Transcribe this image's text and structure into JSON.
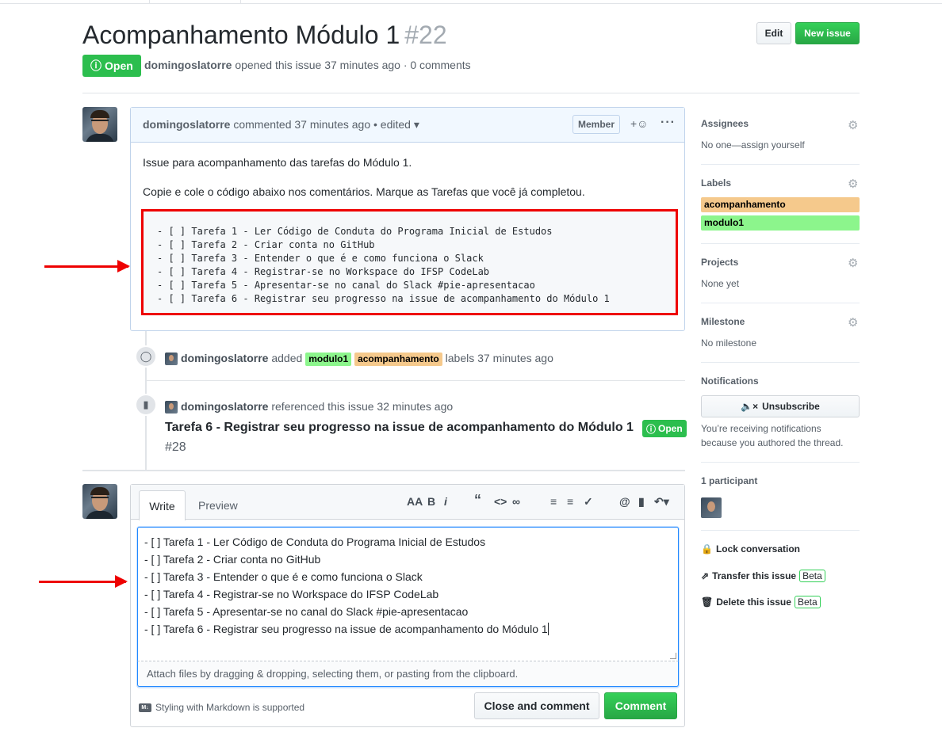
{
  "issue": {
    "title": "Acompanhamento Módulo 1",
    "number": "#22",
    "state": "Open",
    "author": "domingoslatorre",
    "meta_rest": "opened this issue 37 minutes ago · 0 comments"
  },
  "header_buttons": {
    "edit": "Edit",
    "new_issue": "New issue"
  },
  "comment": {
    "author": "domingoslatorre",
    "action": "commented 37 minutes ago • edited",
    "badge": "Member",
    "react": "+☺",
    "more": "···",
    "paragraph1": "Issue para acompanhamento das tarefas do Módulo 1.",
    "paragraph2": "Copie e cole o código abaixo nos comentários. Marque as Tarefas que você já completou.",
    "code_lines": [
      "- [ ] Tarefa 1 - Ler Código de Conduta do Programa Inicial de Estudos",
      "- [ ] Tarefa 2 - Criar conta no GitHub",
      "- [ ] Tarefa 3 - Entender o que é e como funciona o Slack",
      "- [ ] Tarefa 4 - Registrar-se no Workspace do IFSP CodeLab",
      "- [ ] Tarefa 5 - Apresentar-se no canal do Slack #pie-apresentacao",
      "- [ ] Tarefa 6 - Registrar seu progresso na issue de acompanhamento do Módulo 1"
    ]
  },
  "events": {
    "labels_event": {
      "author": "domingoslatorre",
      "verb": "added",
      "label1": "modulo1",
      "label2": "acompanhamento",
      "suffix": "labels 37 minutes ago"
    },
    "ref_event": {
      "author": "domingoslatorre",
      "text": "referenced this issue 32 minutes ago",
      "title": "Tarefa 6 - Registrar seu progresso na issue de acompanhamento do Módulo 1",
      "state": "Open",
      "number": "#28"
    }
  },
  "editor": {
    "tab_write": "Write",
    "tab_preview": "Preview",
    "lines": [
      "- [ ] Tarefa 1 - Ler Código de Conduta do Programa Inicial de Estudos",
      "- [ ] Tarefa 2 - Criar conta no GitHub",
      "- [ ] Tarefa 3 - Entender o que é e como funciona o Slack",
      "- [ ] Tarefa 4 - Registrar-se no Workspace do IFSP CodeLab",
      "- [ ] Tarefa 5 - Apresentar-se no canal do Slack #pie-apresentacao",
      "- [ ] Tarefa 6 - Registrar seu progresso na issue de acompanhamento do Módulo 1"
    ],
    "attach_hint": "Attach files by dragging & dropping, selecting them, or pasting from the clipboard.",
    "markdown_note": "Styling with Markdown is supported",
    "close_button": "Close and comment",
    "comment_button": "Comment"
  },
  "sidebar": {
    "assignees_title": "Assignees",
    "assignees_value": "No one—assign yourself",
    "labels_title": "Labels",
    "labels": [
      {
        "name": "acompanhamento",
        "color": "#f5c98c"
      },
      {
        "name": "modulo1",
        "color": "#8cf58c"
      }
    ],
    "projects_title": "Projects",
    "projects_value": "None yet",
    "milestone_title": "Milestone",
    "milestone_value": "No milestone",
    "notifications_title": "Notifications",
    "unsubscribe": "Unsubscribe",
    "notif_line1": "You’re receiving notifications",
    "notif_line2": "because you authored the thread.",
    "participants": "1 participant",
    "lock": "Lock conversation",
    "transfer": "Transfer this issue",
    "delete": "Delete this issue",
    "beta": "Beta"
  }
}
